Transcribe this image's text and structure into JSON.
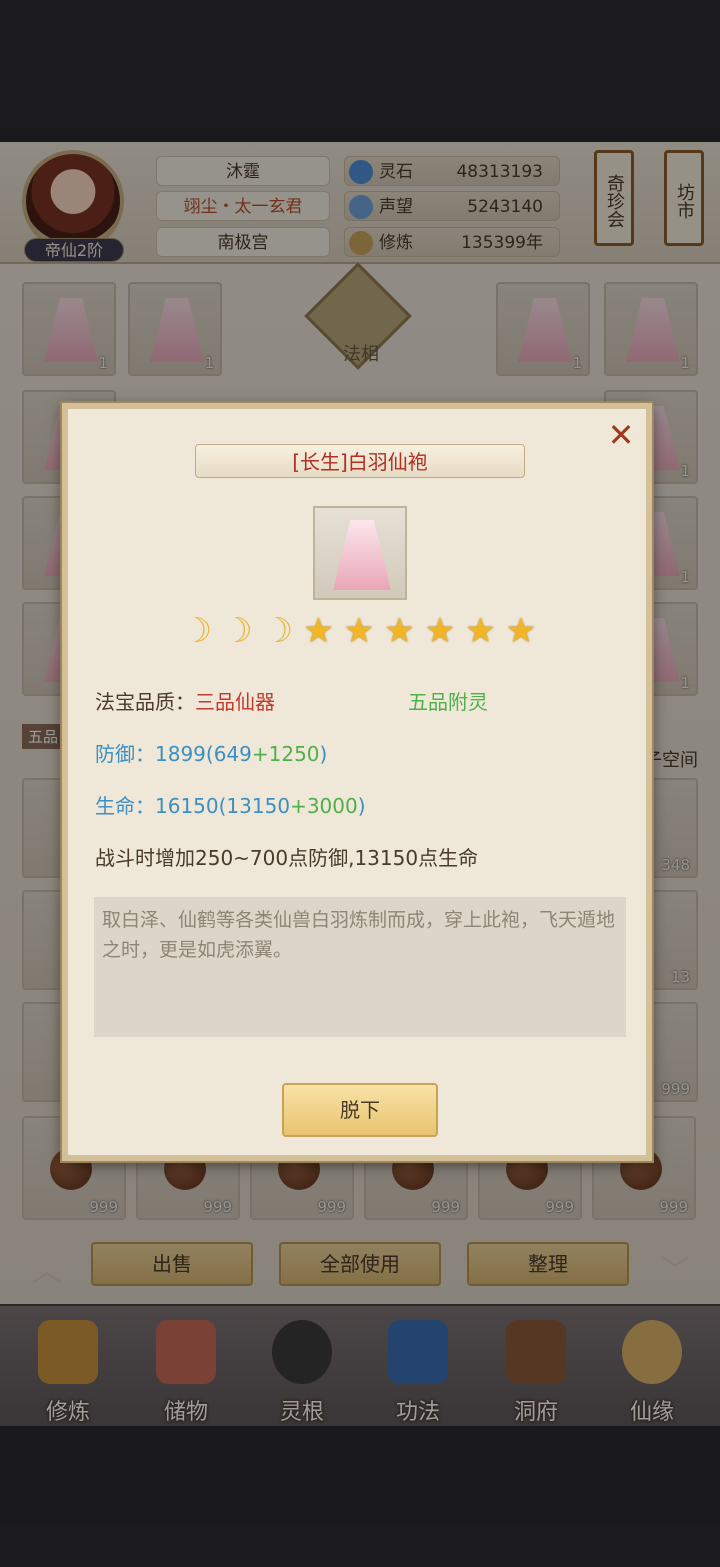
{
  "header": {
    "rank_badge": "帝仙2阶",
    "player_name": "沐霆",
    "player_title": "翊尘・太一玄君",
    "player_palace": "南极宫",
    "resources": [
      {
        "label": "灵石",
        "value": "48313193",
        "icon": "spirit-stone-icon",
        "color": "#4d8fd6"
      },
      {
        "label": "声望",
        "value": "5243140",
        "icon": "crystal-icon",
        "color": "#6fa3d8"
      },
      {
        "label": "修炼",
        "value": "135399年",
        "icon": "meditation-icon",
        "color": "#c9a55c"
      }
    ],
    "banner_left": "奇珍会",
    "banner_right": "坊市"
  },
  "inventory": {
    "center_label": "法相",
    "left_tab": "五品",
    "right_tab": "子空间",
    "robe_slots_count": "1",
    "stack_counts": {
      "a": "348",
      "b": "13",
      "c": "999"
    },
    "buttons": {
      "sell": "出售",
      "use_all": "全部使用",
      "sort": "整理"
    }
  },
  "nav": {
    "items": [
      {
        "label": "修炼",
        "icon": "cultivate-icon",
        "color": "#c9913c"
      },
      {
        "label": "储物",
        "icon": "storage-bag-icon",
        "color": "#c66a5a"
      },
      {
        "label": "灵根",
        "icon": "spirit-root-icon",
        "color": "#3b3b3b"
      },
      {
        "label": "功法",
        "icon": "technique-book-icon",
        "color": "#3b6fb5"
      },
      {
        "label": "洞府",
        "icon": "cave-dwelling-icon",
        "color": "#8a5a3a"
      },
      {
        "label": "仙缘",
        "icon": "immortal-fate-icon",
        "color": "#d9b26a"
      }
    ]
  },
  "modal": {
    "title": "[长生]白羽仙袍",
    "moons": 3,
    "stars": 6,
    "quality_label": "法宝品质：",
    "quality_value": "三品仙器",
    "spirit_tag": "五品附灵",
    "defense_label": "防御：",
    "defense_base": "1899(649",
    "defense_bonus": "+1250",
    "defense_close": ")",
    "life_label": "生命：",
    "life_base": "16150(13150",
    "life_bonus": "+3000",
    "life_close": ")",
    "effect": "战斗时增加250~700点防御,13150点生命",
    "description": "取白泽、仙鹤等各类仙兽白羽炼制而成，穿上此袍，飞天遁地之时，更是如虎添翼。",
    "take_off": "脱下"
  }
}
